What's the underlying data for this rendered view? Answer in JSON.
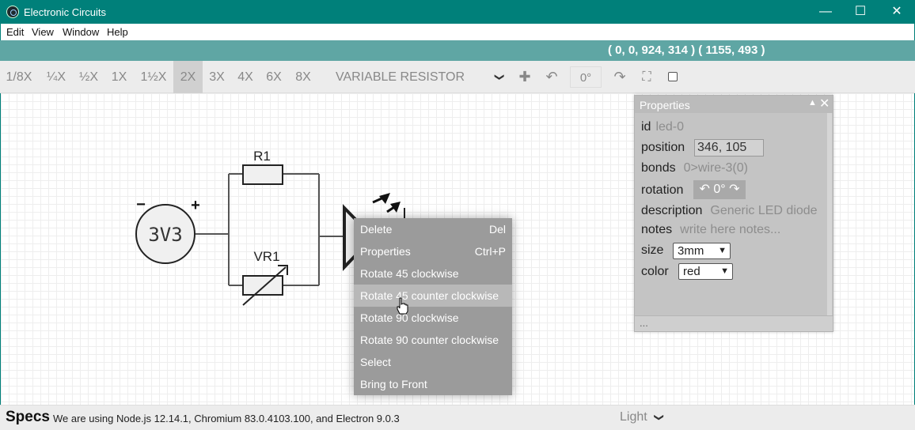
{
  "window": {
    "title": "Electronic Circuits",
    "controls": [
      "minimize",
      "maximize",
      "close"
    ]
  },
  "menu": [
    "Edit",
    "View",
    "Window",
    "Help"
  ],
  "coords": "( 0, 0, 924, 314 )  ( 1155, 493 )",
  "toolbar": {
    "zoom": [
      "1/8X",
      "¼X",
      "½X",
      "1X",
      "1½X",
      "2X",
      "3X",
      "4X",
      "6X",
      "8X"
    ],
    "active_zoom": "2X",
    "component": "VARIABLE RESISTOR",
    "angle": "0°"
  },
  "circuit": {
    "battery": {
      "label": "3V3",
      "minus": "−",
      "plus": "+"
    },
    "r1": "R1",
    "vr1": "VR1"
  },
  "context_menu": {
    "items": [
      {
        "label": "Delete",
        "shortcut": "Del"
      },
      {
        "label": "Properties",
        "shortcut": "Ctrl+P"
      },
      {
        "label": "Rotate 45 clockwise",
        "shortcut": ""
      },
      {
        "label": "Rotate 45 counter clockwise",
        "shortcut": ""
      },
      {
        "label": "Rotate 90 clockwise",
        "shortcut": ""
      },
      {
        "label": "Rotate 90 counter clockwise",
        "shortcut": ""
      },
      {
        "label": "Select",
        "shortcut": ""
      },
      {
        "label": "Bring to Front",
        "shortcut": ""
      }
    ],
    "hovered": "Rotate 45 counter clockwise"
  },
  "properties": {
    "title": "Properties",
    "id_label": "id",
    "id_value": "led-0",
    "position_label": "position",
    "position_value": "346, 105",
    "bonds_label": "bonds",
    "bonds_value": "0>wire-3(0)",
    "rotation_label": "rotation",
    "rotation_value": "0°",
    "description_label": "description",
    "description_value": "Generic LED diode",
    "notes_label": "notes",
    "notes_placeholder": "write here notes...",
    "size_label": "size",
    "size_value": "3mm",
    "color_label": "color",
    "color_value": "red",
    "footer": "..."
  },
  "status": {
    "title": "Specs",
    "text": "We are using Node.js  12.14.1, Chromium 83.0.4103.100, and Electron 9.0.3",
    "theme": "Light"
  },
  "colors": {
    "titlebar": "#00807a",
    "coordbar": "#5fa6a4",
    "menu_bg": "#9b9b9b",
    "menu_hover": "#b8b8b8",
    "props_bg": "#c4c4c4"
  }
}
